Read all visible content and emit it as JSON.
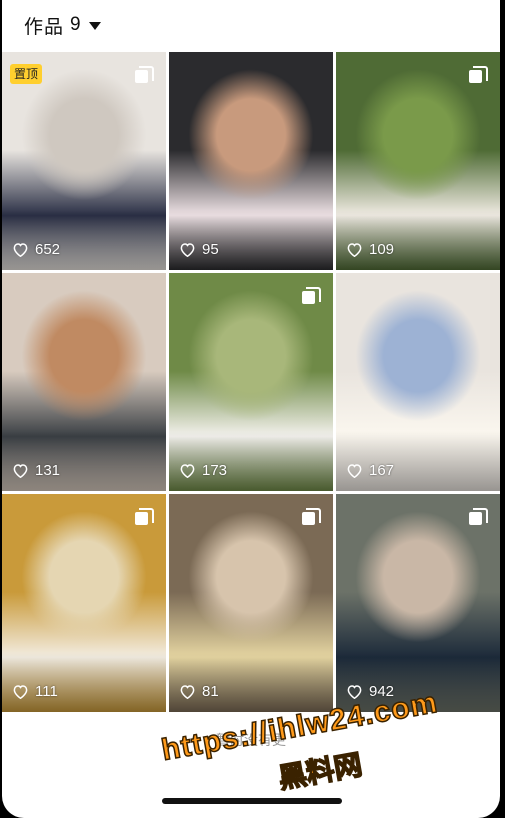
{
  "header": {
    "title": "作品",
    "count": "9"
  },
  "posts": [
    {
      "likes": "652",
      "pinned": true,
      "pin_label": "置顶",
      "multi": true,
      "colors": [
        "#e8e4df",
        "#cfc8c0",
        "#2a2f45"
      ]
    },
    {
      "likes": "95",
      "pinned": false,
      "multi": false,
      "colors": [
        "#2b2b2e",
        "#c89a7d",
        "#efe3e6"
      ]
    },
    {
      "likes": "109",
      "pinned": false,
      "multi": true,
      "colors": [
        "#4f6b35",
        "#7a9a4a",
        "#f1ece4"
      ]
    },
    {
      "likes": "131",
      "pinned": false,
      "multi": false,
      "colors": [
        "#d8cbbf",
        "#c08a62",
        "#3a3f44"
      ]
    },
    {
      "likes": "173",
      "pinned": false,
      "multi": true,
      "colors": [
        "#6f8a47",
        "#a8b77a",
        "#f4f2ee"
      ]
    },
    {
      "likes": "167",
      "pinned": false,
      "multi": false,
      "colors": [
        "#e9e4de",
        "#9db2d4",
        "#fbf7ef"
      ]
    },
    {
      "likes": "111",
      "pinned": false,
      "multi": true,
      "colors": [
        "#c99a3a",
        "#e5d6b2",
        "#f3ede2"
      ]
    },
    {
      "likes": "81",
      "pinned": false,
      "multi": true,
      "colors": [
        "#7b6a55",
        "#d7c4ac",
        "#e6d6a2"
      ]
    },
    {
      "likes": "942",
      "pinned": false,
      "multi": true,
      "colors": [
        "#6c7268",
        "#c9b7a6",
        "#1c2a3a"
      ]
    }
  ],
  "footer": {
    "text": "暂时没有更"
  },
  "watermark": {
    "line1": "https://ihlw24.com",
    "line2": "黑料网"
  }
}
